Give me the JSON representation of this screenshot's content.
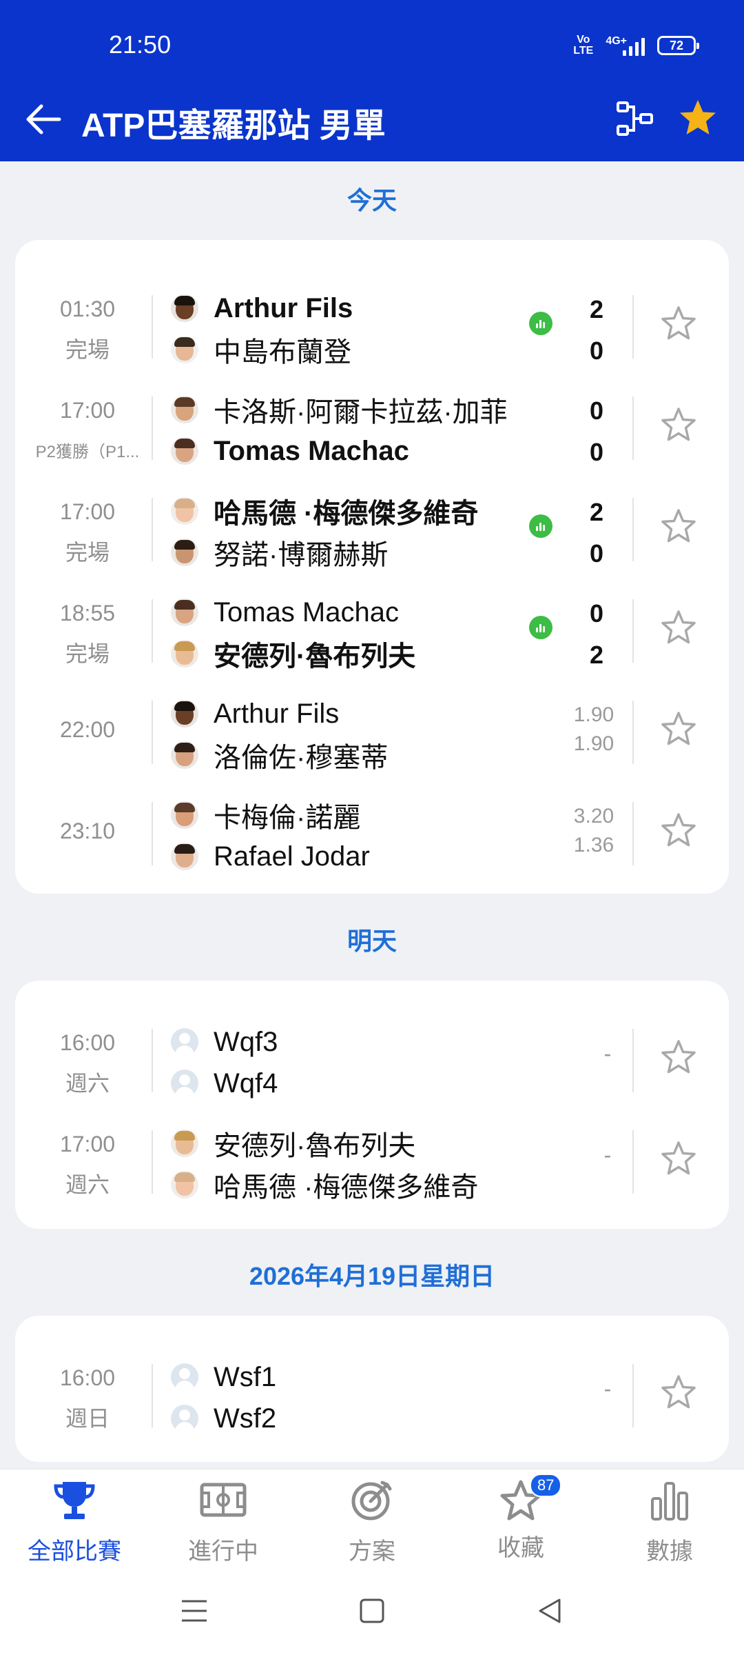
{
  "status": {
    "time": "21:50",
    "volte": "Vo\nLTE",
    "network": "4G+",
    "battery": "72"
  },
  "header": {
    "title": "ATP巴塞羅那站 男單",
    "back_icon": "arrow-left-icon",
    "bracket_icon": "bracket-icon",
    "favorite_icon": "star-icon",
    "accent": "#f5b315"
  },
  "sections": {
    "today": "今天",
    "tomorrow": "明天",
    "sunday": "2026年4月19日星期日"
  },
  "matches_today": [
    {
      "time": "01:30",
      "status": "完場",
      "p1": "Arthur Fils",
      "p2": "中島布蘭登",
      "s1": "2",
      "s2": "0",
      "winner": 1,
      "stats": true
    },
    {
      "time": "17:00",
      "status": "P2獲勝（P1...",
      "p1": "卡洛斯·阿爾卡拉茲·加菲",
      "p2": "Tomas Machac",
      "s1": "0",
      "s2": "0",
      "winner": 2,
      "stats": false
    },
    {
      "time": "17:00",
      "status": "完場",
      "p1": "哈馬德 ·梅德傑多維奇",
      "p2": "努諾·博爾赫斯",
      "s1": "2",
      "s2": "0",
      "winner": 1,
      "stats": true
    },
    {
      "time": "18:55",
      "status": "完場",
      "p1": "Tomas Machac",
      "p2": "安德列·魯布列夫",
      "s1": "0",
      "s2": "2",
      "winner": 2,
      "stats": true
    },
    {
      "time": "22:00",
      "p1": "Arthur Fils",
      "p2": "洛倫佐·穆塞蒂",
      "o1": "1.90",
      "o2": "1.90"
    },
    {
      "time": "23:10",
      "p1": "卡梅倫·諾麗",
      "p2": "Rafael Jodar",
      "o1": "3.20",
      "o2": "1.36"
    }
  ],
  "matches_tomorrow": [
    {
      "time": "16:00",
      "status": "週六",
      "p1": "Wqf3",
      "p2": "Wqf4",
      "dash": "-"
    },
    {
      "time": "17:00",
      "status": "週六",
      "p1": "安德列·魯布列夫",
      "p2": "哈馬德 ·梅德傑多維奇",
      "dash": "-"
    }
  ],
  "matches_sunday": [
    {
      "time": "16:00",
      "status": "週日",
      "p1": "Wsf1",
      "p2": "Wsf2",
      "dash": "-"
    }
  ],
  "nav": {
    "all": "全部比賽",
    "live": "進行中",
    "plans": "方案",
    "favorites": "收藏",
    "favorites_badge": "87",
    "data": "數據"
  }
}
